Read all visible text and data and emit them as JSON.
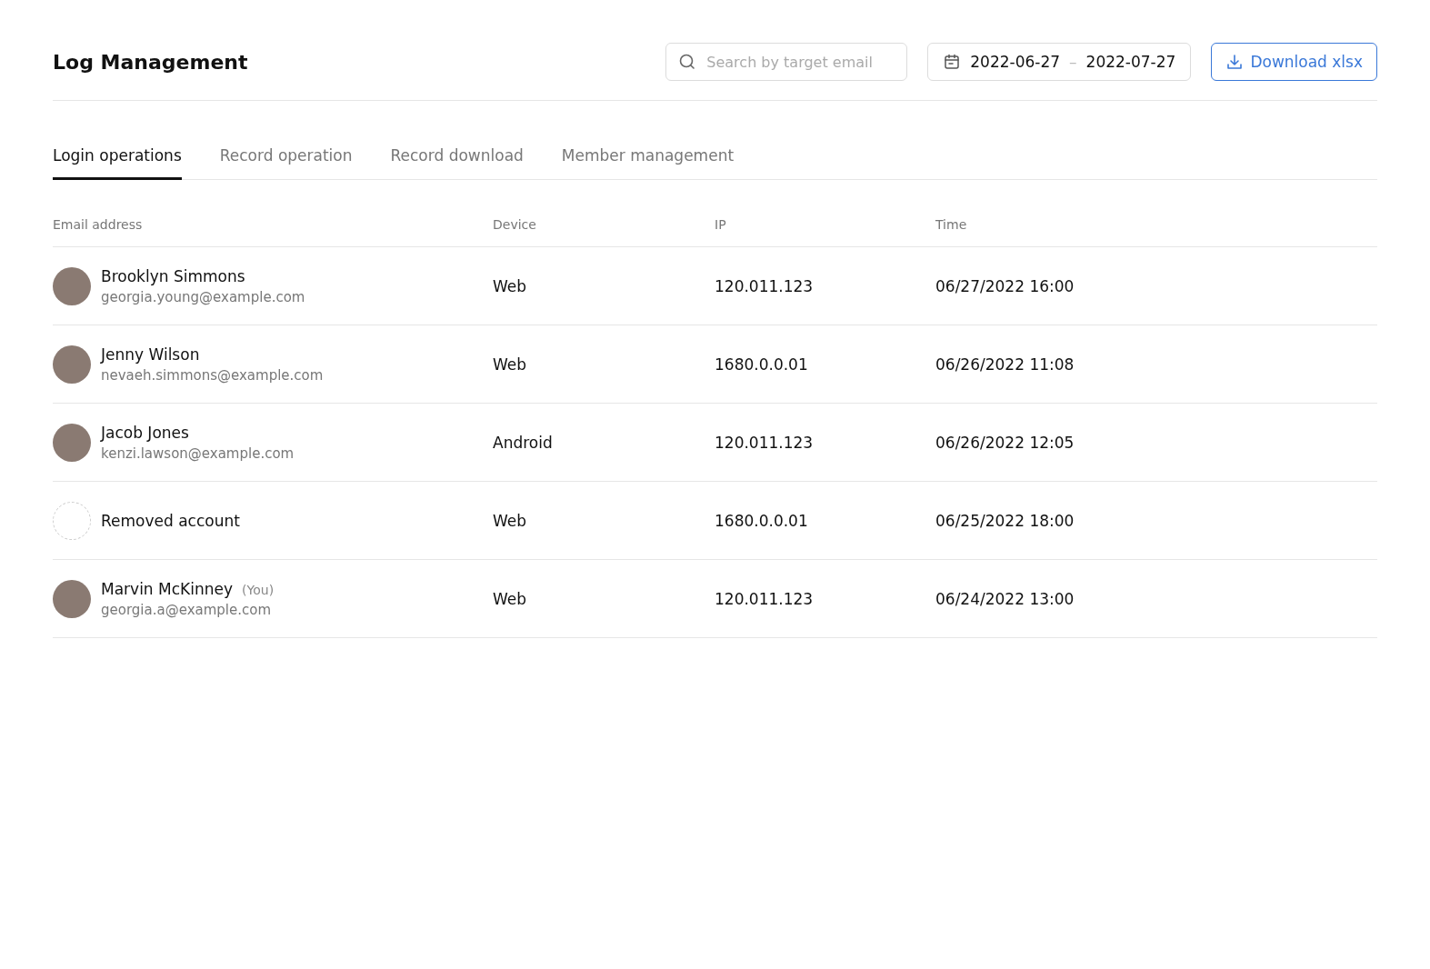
{
  "page": {
    "title": "Log Management"
  },
  "search": {
    "placeholder": "Search by target email"
  },
  "date_range": {
    "start": "2022-06-27",
    "separator": "–",
    "end": "2022-07-27"
  },
  "download_button": {
    "label": "Download xlsx"
  },
  "tabs": [
    {
      "label": "Login operations",
      "selected": true
    },
    {
      "label": "Record operation",
      "selected": false
    },
    {
      "label": "Record download",
      "selected": false
    },
    {
      "label": "Member management",
      "selected": false
    }
  ],
  "table": {
    "columns": [
      "Email address",
      "Device",
      "IP",
      "Time"
    ],
    "rows": [
      {
        "kind": "photo",
        "name": "Brooklyn Simmons",
        "email": "georgia.young@example.com",
        "device": "Web",
        "ip": "120.011.123",
        "time": "06/27/2022 16:00"
      },
      {
        "kind": "photo",
        "name": "Jenny Wilson",
        "email": "nevaeh.simmons@example.com",
        "device": "Web",
        "ip": "1680.0.0.01",
        "time": "06/26/2022 11:08"
      },
      {
        "kind": "photo",
        "name": "Jacob Jones",
        "email": "kenzi.lawson@example.com",
        "device": "Android",
        "ip": "120.011.123",
        "time": "06/26/2022 12:05"
      },
      {
        "kind": "removed",
        "name": "Removed account",
        "device": "Web",
        "ip": "1680.0.0.01",
        "time": "06/25/2022 18:00"
      },
      {
        "kind": "photo",
        "name": "Marvin McKinney",
        "tag": "(You)",
        "email": "georgia.a@example.com",
        "device": "Web",
        "ip": "120.011.123",
        "time": "06/24/2022 13:00"
      }
    ]
  }
}
